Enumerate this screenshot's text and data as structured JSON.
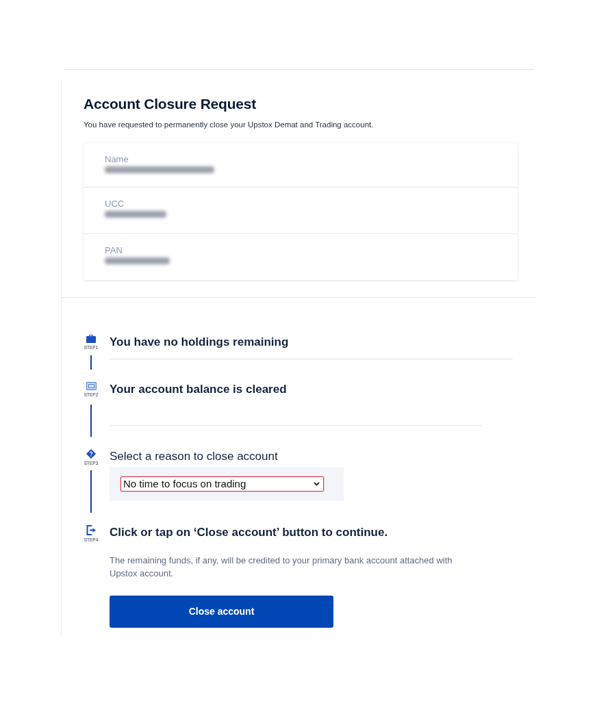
{
  "page": {
    "title": "Account Closure Request",
    "subtitle": "You have requested to permanently close your Upstox Demat and Trading account."
  },
  "details": [
    {
      "label": "Name",
      "blurred": true
    },
    {
      "label": "UCC",
      "blurred": true
    },
    {
      "label": "PAN",
      "blurred": true
    }
  ],
  "steps": [
    {
      "kind": "status",
      "step": "STEP1",
      "title": "You have no holdings remaining"
    },
    {
      "kind": "status",
      "step": "STEP2",
      "title": "Your account balance is cleared"
    },
    {
      "kind": "select",
      "step": "STEP3",
      "title": "Select a reason to close account",
      "reason": {
        "value": "No time to focus on trading",
        "focused": true
      }
    },
    {
      "kind": "action",
      "step": "STEP4",
      "title": "Click or tap on ‘Close account’ button to continue.",
      "note": "The remaining funds, if any, will be credited to your primary bank account attached with Upstox account.",
      "button": "Close account"
    }
  ]
}
